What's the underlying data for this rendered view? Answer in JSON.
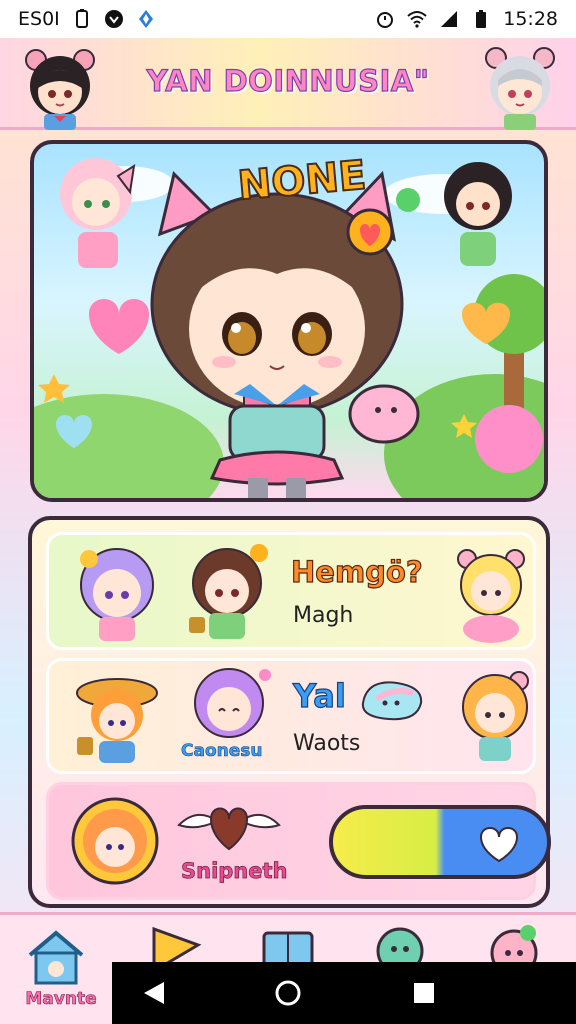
{
  "status_bar": {
    "left_text": "ES0I",
    "time": "15:28",
    "icons": [
      "battery-saver-icon",
      "shield-icon",
      "bluetooth-icon",
      "alarm-icon",
      "wifi-icon",
      "signal-icon",
      "battery-icon"
    ]
  },
  "header": {
    "title": "YAN DOINNUSIA\""
  },
  "hero": {
    "title": "NONE"
  },
  "rows": {
    "row1": {
      "title": "Hemgö?",
      "subtitle": "Magh"
    },
    "row2": {
      "title": "Yal",
      "subtitle": "Waots",
      "caption": "Caonesu"
    },
    "row3": {
      "caption": "Snipneth"
    }
  },
  "bottom_nav": {
    "items": [
      {
        "label": "Mavnte",
        "icon": "home-icon"
      },
      {
        "label": "",
        "icon": "play-icon"
      },
      {
        "label": "",
        "icon": "book-icon"
      },
      {
        "label": "",
        "icon": "character-icon"
      },
      {
        "label": "",
        "icon": "profile-icon"
      }
    ]
  },
  "colors": {
    "accent_pink": "#ff86c0",
    "accent_orange": "#ff8a2a",
    "accent_blue": "#3a9ef5",
    "outline": "#3a2a3a"
  }
}
